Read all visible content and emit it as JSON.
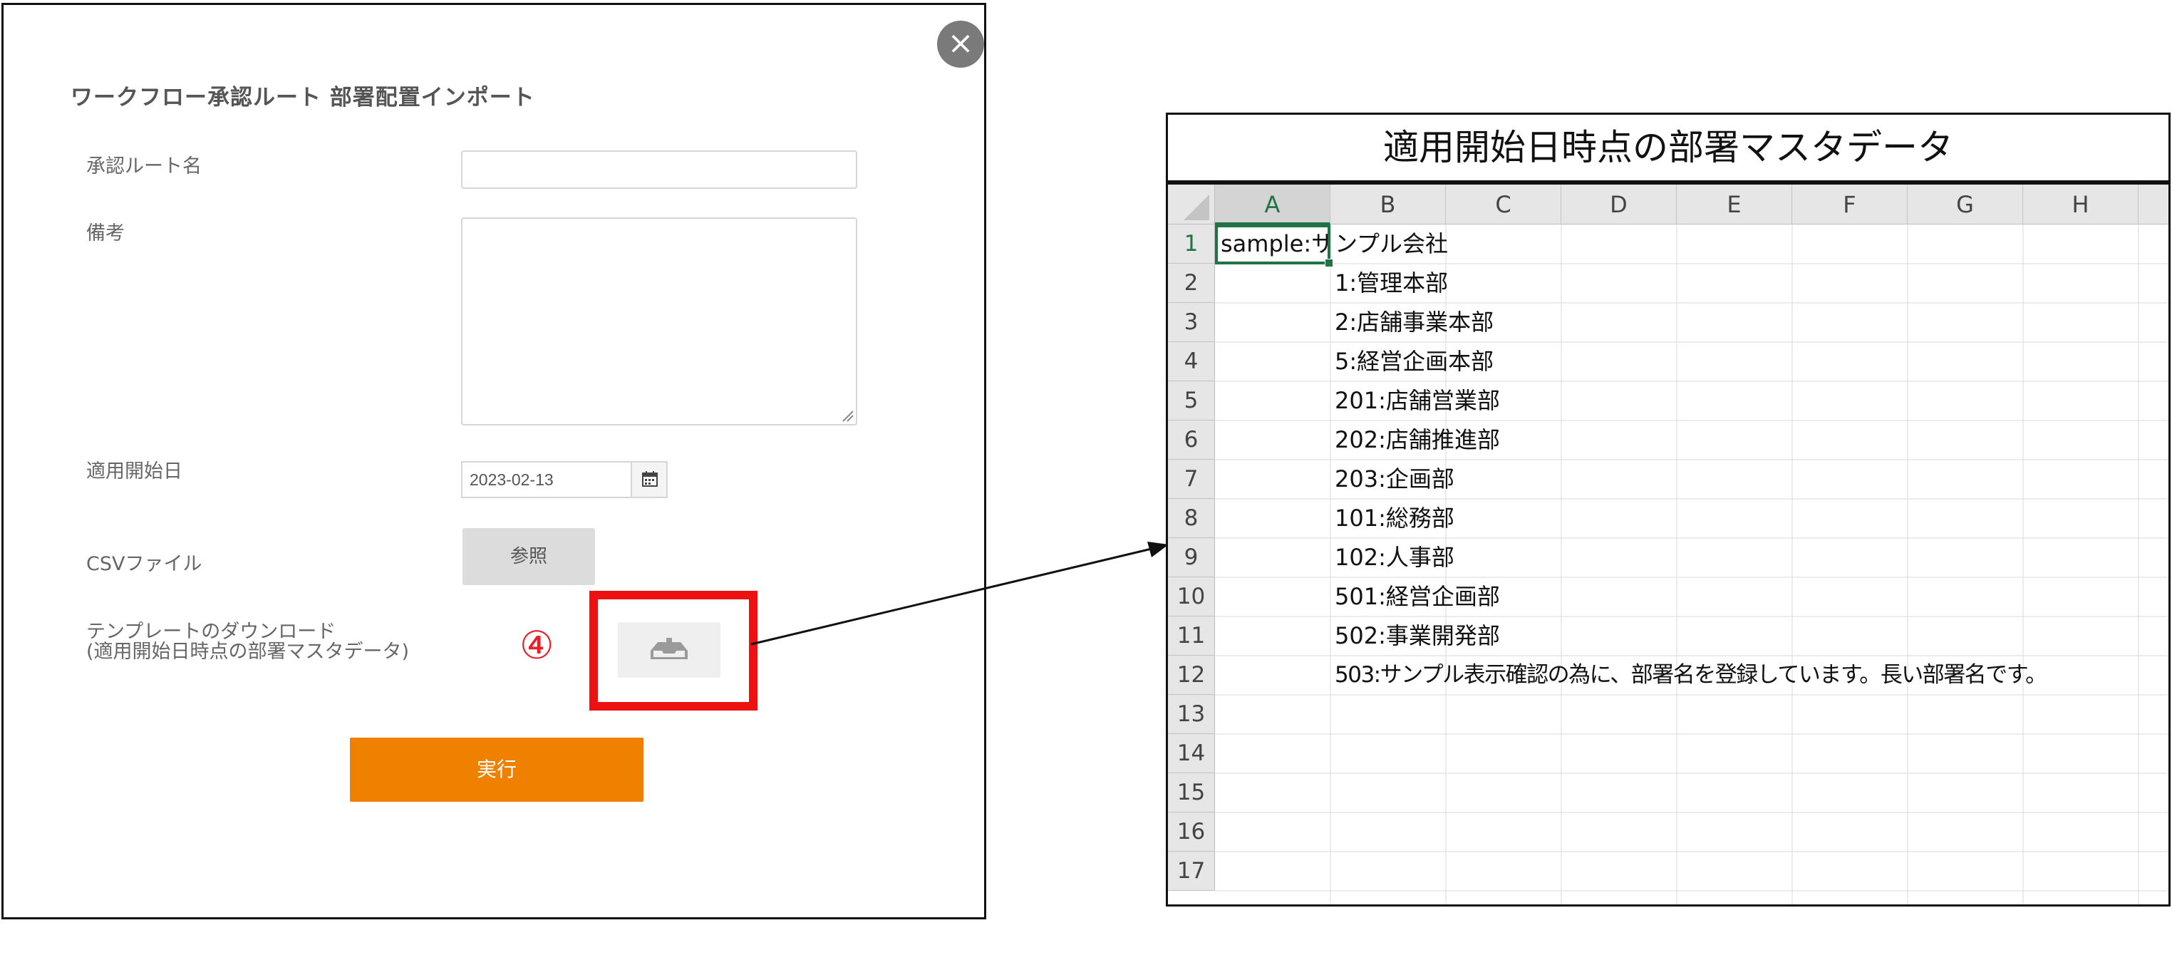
{
  "dialog": {
    "title": "ワークフロー承認ルート 部署配置インポート",
    "close_symbol": "×",
    "fields": {
      "route_name_label": "承認ルート名",
      "route_name_value": "",
      "remarks_label": "備考",
      "remarks_value": "",
      "start_date_label": "適用開始日",
      "start_date_value": "2023-02-13",
      "csv_label": "CSVファイル",
      "browse_label": "参照",
      "template_label_line1": "テンプレートのダウンロード",
      "template_label_line2": "(適用開始日時点の部署マスタデータ)"
    },
    "step_marker": "④",
    "execute_label": "実行",
    "icons": {
      "close": "close-icon",
      "calendar": "calendar-icon",
      "download": "download-icon"
    },
    "colors": {
      "execute": "#ef8000",
      "highlight": "#ee1111",
      "step_marker": "#e8202a"
    }
  },
  "spreadsheet": {
    "caption": "適用開始日時点の部署マスタデータ",
    "columns": [
      "A",
      "B",
      "C",
      "D",
      "E",
      "F",
      "G",
      "H"
    ],
    "active_column": "A",
    "rows": [
      "1",
      "2",
      "3",
      "4",
      "5",
      "6",
      "7",
      "8",
      "9",
      "10",
      "11",
      "12",
      "13",
      "14",
      "15",
      "16",
      "17"
    ],
    "active_row": "1",
    "cells": {
      "a1": "sample:サ",
      "b1": "ンプル会社",
      "b2": "1:管理本部",
      "b3": "2:店舗事業本部",
      "b4": "5:経営企画本部",
      "b5": "201:店舗営業部",
      "b6": "202:店舗推進部",
      "b7": "203:企画部",
      "b8": "101:総務部",
      "b9": "102:人事部",
      "b10": "501:経営企画部",
      "b11": "502:事業開発部",
      "b12": "503:サンプル表示確認の為に、部署名を登録しています。長い部署名です。"
    },
    "colors": {
      "selection": "#217346",
      "header_bg": "#e6e6e6"
    }
  }
}
